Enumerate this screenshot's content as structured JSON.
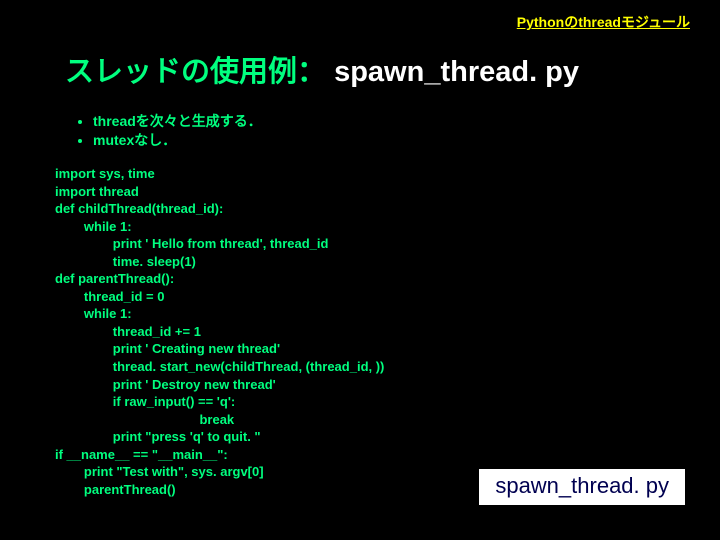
{
  "top_link": "Pythonのthreadモジュール",
  "title": {
    "green": "スレッドの使用例：",
    "white": " spawn_thread. py"
  },
  "bullets": [
    "threadを次々と生成する．",
    "mutexなし．"
  ],
  "code": "import sys, time\nimport thread\ndef childThread(thread_id):\n        while 1:\n                print ' Hello from thread', thread_id\n                time. sleep(1)\ndef parentThread():\n        thread_id = 0\n        while 1:\n                thread_id += 1\n                print ' Creating new thread'\n                thread. start_new(childThread, (thread_id, ))\n                print ' Destroy new thread'\n                if raw_input() == 'q':\n                                        break\n                print \"press 'q' to quit. \"\nif __name__ == \"__main__\":\n        print \"Test with\", sys. argv[0]\n        parentThread()",
  "filebox": "spawn_thread. py"
}
